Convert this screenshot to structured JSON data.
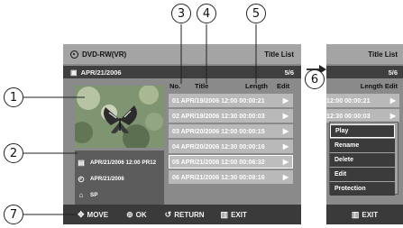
{
  "callouts": [
    "1",
    "2",
    "3",
    "4",
    "5",
    "6",
    "7"
  ],
  "header": {
    "disc_label": "DVD-RW(VR)",
    "screen_title": "Title List"
  },
  "subheader": {
    "playlist_date": "APR/21/2006",
    "page": "5/6"
  },
  "columns": {
    "no": "No.",
    "title": "Title",
    "length": "Length",
    "edit": "Edit"
  },
  "titles": [
    {
      "label": "01 APR/19/2006 12:00",
      "length": "00:00:21"
    },
    {
      "label": "02 APR/19/2006 12:30",
      "length": "00:00:03"
    },
    {
      "label": "03 APR/20/2006 12:00",
      "length": "00:00:15"
    },
    {
      "label": "04 APR/20/2006 12:30",
      "length": "00:00:16"
    },
    {
      "label": "05 APR/21/2006 12:00",
      "length": "00:06:32"
    },
    {
      "label": "06 APR/21/2006 12:30",
      "length": "00:08:16"
    }
  ],
  "selected_index": 4,
  "info": {
    "datetime": "APR/21/2006 12:00 PR12",
    "date": "APR/21/2006",
    "mode": "SP"
  },
  "footer": {
    "move": "MOVE",
    "ok": "OK",
    "return": "RETURN",
    "exit": "EXIT"
  },
  "right_panel": {
    "title": "Title List",
    "page": "5/6",
    "col_header": "Length  Edit",
    "rows": [
      "12:00  00:00:21",
      "12:30  00:00:03"
    ],
    "menu": [
      "Play",
      "Rename",
      "Delete",
      "Edit",
      "Protection"
    ],
    "menu_selected": 0,
    "exit": "EXIT"
  },
  "colors": {
    "panel": "#8a8a8a",
    "bar_dark": "#3a3a3a",
    "row": "#b9b9b9",
    "header": "#a4a4a4"
  }
}
